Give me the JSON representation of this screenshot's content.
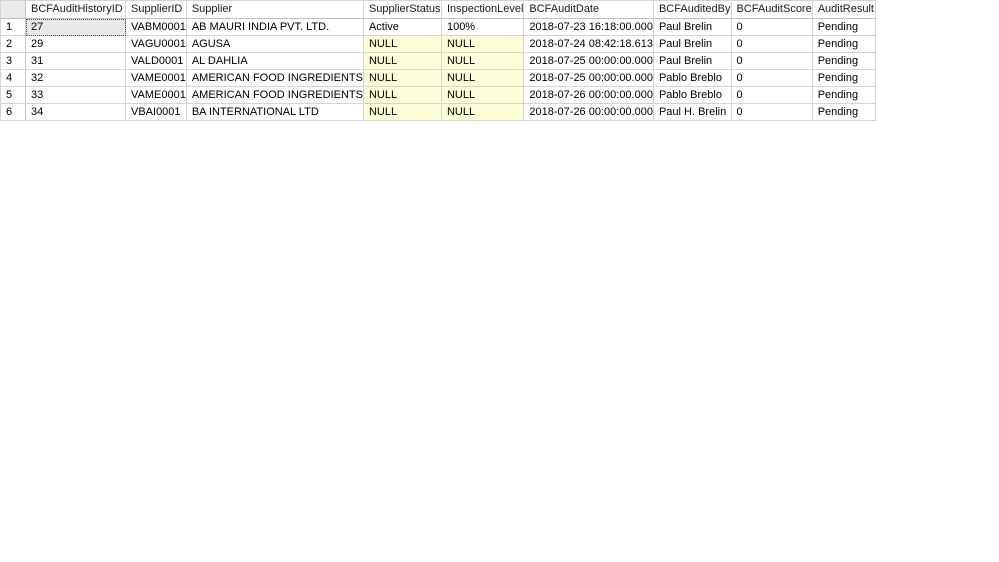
{
  "grid": {
    "columns": [
      {
        "key": "rownum",
        "label": "",
        "class": "col-gutter"
      },
      {
        "key": "BCFAuditHistoryID",
        "label": "BCFAuditHistoryID",
        "class": "col-auditid"
      },
      {
        "key": "SupplierID",
        "label": "SupplierID",
        "class": "col-supplierid"
      },
      {
        "key": "Supplier",
        "label": "Supplier",
        "class": "col-supplier"
      },
      {
        "key": "SupplierStatus",
        "label": "SupplierStatus",
        "class": "col-supplierstat"
      },
      {
        "key": "InspectionLevel",
        "label": "InspectionLevel",
        "class": "col-inspection"
      },
      {
        "key": "BCFAuditDate",
        "label": "BCFAuditDate",
        "class": "col-auditdate"
      },
      {
        "key": "BCFAuditedBy",
        "label": "BCFAuditedBy",
        "class": "col-auditedby"
      },
      {
        "key": "BCFAuditScore",
        "label": "BCFAuditScore",
        "class": "col-auditscore"
      },
      {
        "key": "AuditResult",
        "label": "AuditResult",
        "class": "col-auditresult"
      }
    ],
    "null_token": "NULL",
    "colors": {
      "null_cell_background": "#fdfdd8",
      "grid_line": "#d4d4d4",
      "gutter_header_background": "#ebebeb",
      "focused_cell_background": "#e8e8e8",
      "page_background": "#ffffff",
      "text": "#000000"
    },
    "focused_cell": {
      "row": 1,
      "column": "BCFAuditHistoryID"
    },
    "row_count": 6,
    "rows": [
      {
        "rownum": "1",
        "BCFAuditHistoryID": "27",
        "SupplierID": "VABM0001",
        "Supplier": "AB MAURI INDIA PVT. LTD.",
        "SupplierStatus": "Active",
        "InspectionLevel": "100%",
        "BCFAuditDate": "2018-07-23 16:18:00.000",
        "BCFAuditedBy": "Paul Brelin",
        "BCFAuditScore": "0",
        "AuditResult": "Pending"
      },
      {
        "rownum": "2",
        "BCFAuditHistoryID": "29",
        "SupplierID": "VAGU0001",
        "Supplier": "AGUSA",
        "SupplierStatus": "NULL",
        "InspectionLevel": "NULL",
        "BCFAuditDate": "2018-07-24 08:42:18.613",
        "BCFAuditedBy": "Paul Brelin",
        "BCFAuditScore": "0",
        "AuditResult": "Pending"
      },
      {
        "rownum": "3",
        "BCFAuditHistoryID": "31",
        "SupplierID": "VALD0001",
        "Supplier": "AL DAHLIA",
        "SupplierStatus": "NULL",
        "InspectionLevel": "NULL",
        "BCFAuditDate": "2018-07-25 00:00:00.000",
        "BCFAuditedBy": "Paul Brelin",
        "BCFAuditScore": "0",
        "AuditResult": "Pending"
      },
      {
        "rownum": "4",
        "BCFAuditHistoryID": "32",
        "SupplierID": "VAME0001",
        "Supplier": "AMERICAN FOOD INGREDIENTS",
        "SupplierStatus": "NULL",
        "InspectionLevel": "NULL",
        "BCFAuditDate": "2018-07-25 00:00:00.000",
        "BCFAuditedBy": "Pablo Breblo",
        "BCFAuditScore": "0",
        "AuditResult": "Pending"
      },
      {
        "rownum": "5",
        "BCFAuditHistoryID": "33",
        "SupplierID": "VAME0001",
        "Supplier": "AMERICAN FOOD INGREDIENTS",
        "SupplierStatus": "NULL",
        "InspectionLevel": "NULL",
        "BCFAuditDate": "2018-07-26 00:00:00.000",
        "BCFAuditedBy": "Pablo Breblo",
        "BCFAuditScore": "0",
        "AuditResult": "Pending"
      },
      {
        "rownum": "6",
        "BCFAuditHistoryID": "34",
        "SupplierID": "VBAI0001",
        "Supplier": "BA INTERNATIONAL LTD",
        "SupplierStatus": "NULL",
        "InspectionLevel": "NULL",
        "BCFAuditDate": "2018-07-26 00:00:00.000",
        "BCFAuditedBy": "Paul H. Brelin",
        "BCFAuditScore": "0",
        "AuditResult": "Pending"
      }
    ]
  }
}
